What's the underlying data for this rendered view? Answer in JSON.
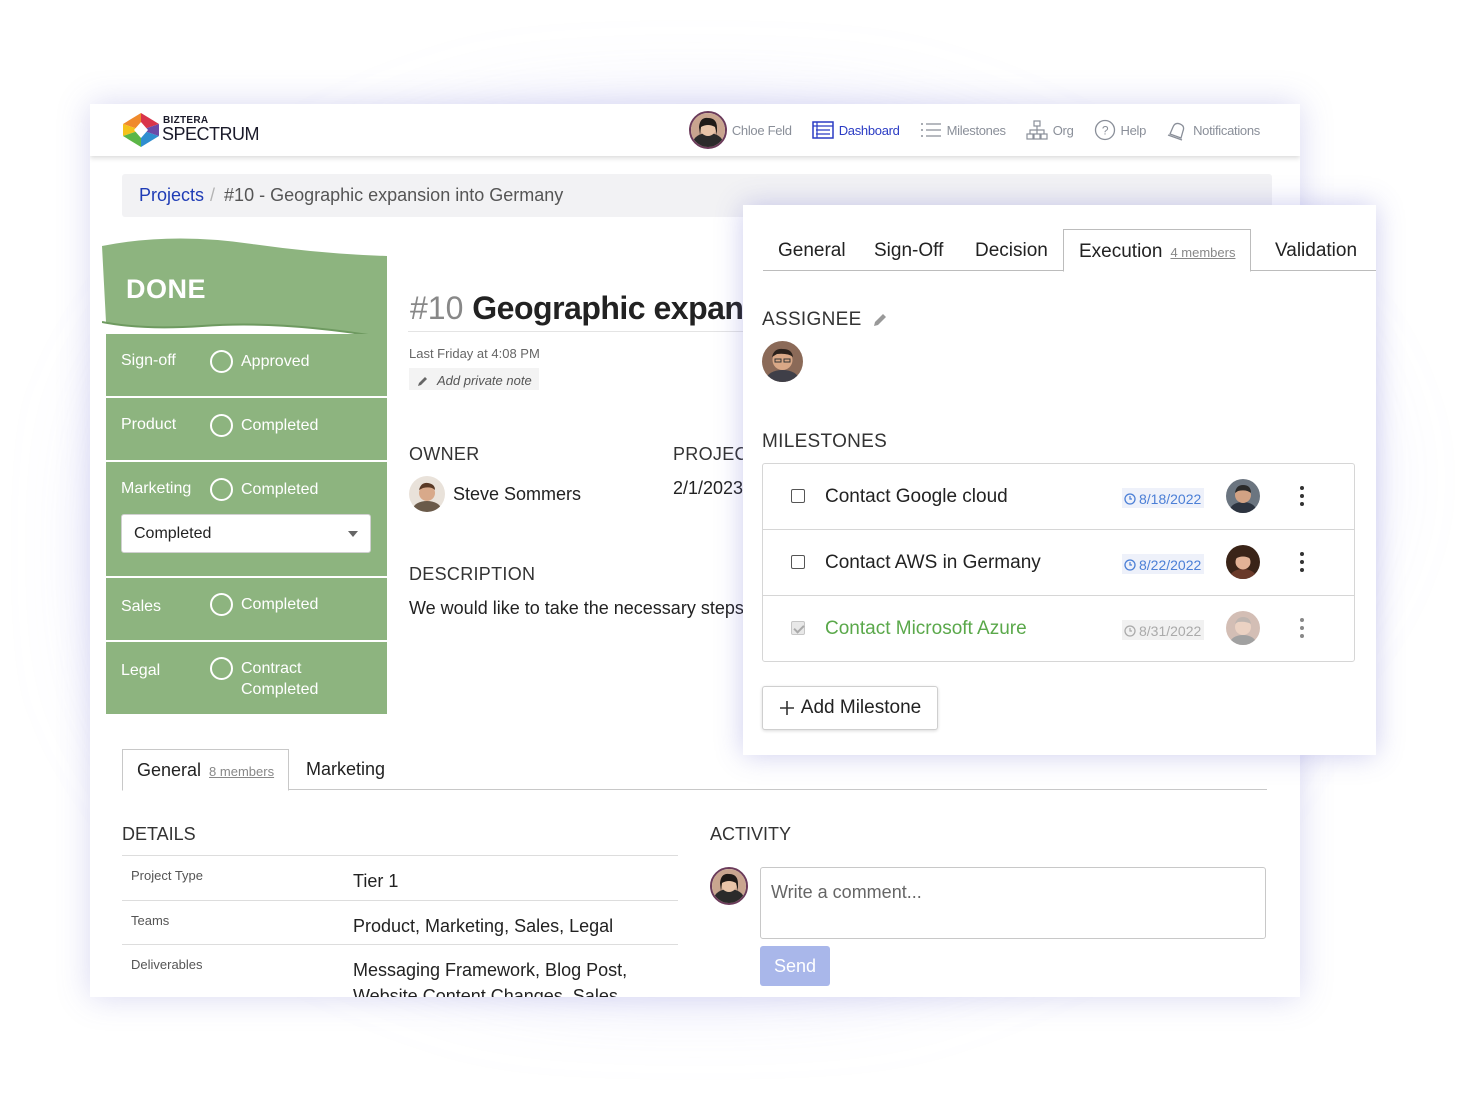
{
  "brand": {
    "small": "BIZTERA",
    "big": "SPECTRUM"
  },
  "nav": {
    "user": "Chloe Feld",
    "items": [
      {
        "label": "Dashboard",
        "icon": "dashboard-icon",
        "active": true
      },
      {
        "label": "Milestones",
        "icon": "list-icon"
      },
      {
        "label": "Org",
        "icon": "org-chart-icon"
      },
      {
        "label": "Help",
        "icon": "help-icon"
      },
      {
        "label": "Notifications",
        "icon": "bell-icon"
      }
    ]
  },
  "breadcrumb": {
    "root": "Projects",
    "separator": "/",
    "current": "#10 - Geographic expansion into Germany"
  },
  "status": {
    "header": "DONE",
    "color": "#8db47f",
    "rows": [
      {
        "label": "Sign-off",
        "value": "Approved"
      },
      {
        "label": "Product",
        "value": "Completed"
      },
      {
        "label": "Marketing",
        "value": "Completed",
        "select": "Completed"
      },
      {
        "label": "Sales",
        "value": "Completed"
      },
      {
        "label": "Legal",
        "value_line1": "Contract",
        "value_line2": "Completed"
      }
    ]
  },
  "project": {
    "number": "#10",
    "title": "Geographic expansi",
    "timestamp": "Last Friday at 4:08 PM",
    "private_note": "Add private note",
    "owner_label": "OWNER",
    "owner": "Steve Sommers",
    "project_label": "PROJECT",
    "project_date": "2/1/2023",
    "description_label": "DESCRIPTION",
    "description": "We would like to take the necessary steps"
  },
  "lower_tabs": [
    {
      "label": "General",
      "members": "8 members",
      "active": true
    },
    {
      "label": "Marketing"
    }
  ],
  "details": {
    "label": "DETAILS",
    "rows": [
      {
        "key": "Project Type",
        "value": "Tier 1"
      },
      {
        "key": "Teams",
        "value": "Product, Marketing, Sales, Legal"
      },
      {
        "key": "Deliverables",
        "value": "Messaging Framework, Blog Post, Website Content Changes, Sales"
      }
    ]
  },
  "activity": {
    "label": "ACTIVITY",
    "placeholder": "Write a comment...",
    "send": "Send"
  },
  "card": {
    "tabs": [
      {
        "label": "General"
      },
      {
        "label": "Sign-Off"
      },
      {
        "label": "Decision"
      },
      {
        "label": "Execution",
        "members": "4 members",
        "active": true
      },
      {
        "label": "Validation"
      }
    ],
    "assignee_label": "ASSIGNEE",
    "milestones_label": "MILESTONES",
    "milestones": [
      {
        "name": "Contact Google cloud",
        "date": "8/18/2022",
        "done": false
      },
      {
        "name": "Contact AWS in Germany",
        "date": "8/22/2022",
        "done": false
      },
      {
        "name": "Contact Microsoft Azure",
        "date": "8/31/2022",
        "done": true
      }
    ],
    "add_button": "Add Milestone"
  }
}
